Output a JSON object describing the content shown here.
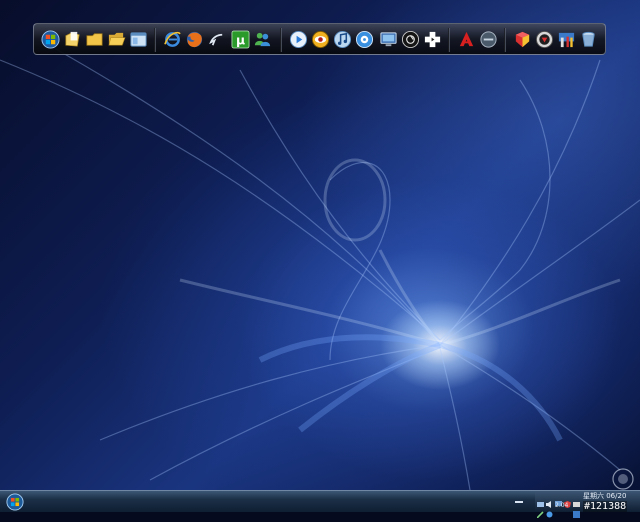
{
  "dock": {
    "groups": [
      {
        "id": "system",
        "icons": [
          {
            "name": "windows-orb-icon",
            "color": "#3a8fd8"
          },
          {
            "name": "document-folder-icon",
            "color": "#e8c24a"
          },
          {
            "name": "folder-icon",
            "color": "#f0c040"
          },
          {
            "name": "open-folder-icon",
            "color": "#f0b838"
          },
          {
            "name": "window-explorer-icon",
            "color": "#6fa8e0"
          }
        ]
      },
      {
        "id": "internet",
        "icons": [
          {
            "name": "internet-explorer-icon",
            "color": "#3b8be0"
          },
          {
            "name": "firefox-icon",
            "color": "#e86a1a"
          },
          {
            "name": "arrow-back-icon",
            "color": "#cfd8e6"
          },
          {
            "name": "utorrent-icon",
            "color": "#2fa02f",
            "glyph": "µ"
          },
          {
            "name": "messenger-icon",
            "color": "#4fb34f"
          }
        ]
      },
      {
        "id": "media",
        "icons": [
          {
            "name": "media-play-icon",
            "color": "#2a7ad8"
          },
          {
            "name": "media-eye-icon",
            "color": "#f0b020"
          },
          {
            "name": "music-note-icon",
            "color": "#7ab0e0"
          },
          {
            "name": "media-disc-icon",
            "color": "#3a90e0"
          },
          {
            "name": "display-monitor-icon",
            "color": "#5a90c8"
          },
          {
            "name": "media-player-black-icon",
            "color": "#202020"
          },
          {
            "name": "plus-tile-icon",
            "color": "#ffffff"
          }
        ]
      },
      {
        "id": "tools",
        "icons": [
          {
            "name": "adobe-acrobat-icon",
            "color": "#d82020"
          },
          {
            "name": "round-badge-icon",
            "color": "#5a6a7a"
          }
        ]
      },
      {
        "id": "utilities",
        "icons": [
          {
            "name": "shield-cube-icon",
            "color": "#d83030"
          },
          {
            "name": "round-logo-icon",
            "color": "#c03030"
          },
          {
            "name": "tools-icon",
            "color": "#3a7ac8"
          },
          {
            "name": "recycle-bin-icon",
            "color": "#8ab0d8"
          }
        ]
      }
    ]
  },
  "taskbar": {
    "start_icon": "windows-orb-icon",
    "show_desktop_icon": "show-desktop-icon",
    "tray_icons": [
      "network-icon",
      "volume-icon",
      "monitor-icon",
      "shield-icon",
      "pen-icon",
      "globe-icon",
      "battery-icon",
      "language-icon"
    ],
    "tray_label": "2.04",
    "clock_date": "星期六 06/20",
    "clock_time": "#121388"
  },
  "colors": {
    "taskbar_top": "#3b5775",
    "taskbar_bottom": "#0f1f33",
    "desktop_dark": "#070d2a",
    "desktop_glow": "#bcd8ff"
  }
}
